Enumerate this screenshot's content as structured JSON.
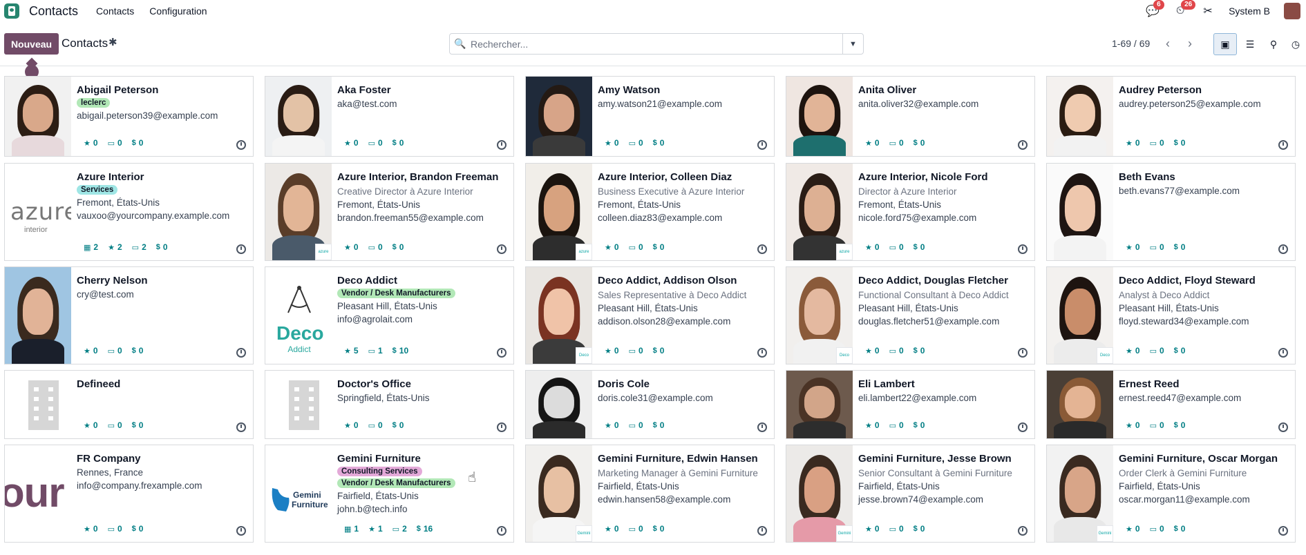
{
  "topnav": {
    "app_name": "Contacts",
    "menu": [
      "Contacts",
      "Configuration"
    ],
    "messages_count": "6",
    "activities_count": "26",
    "user": "System B"
  },
  "control_panel": {
    "new_button": "Nouveau",
    "title": "Contacts",
    "search_placeholder": "Rechercher...",
    "pager": "1-69 / 69"
  },
  "cards": [
    {
      "name": "Abigail Peterson",
      "tags": [
        {
          "label": "leclerc",
          "color": "green"
        }
      ],
      "lines": [
        "abigail.peterson39@example.com"
      ],
      "stats": [
        {
          "icon": "star",
          "val": "0"
        },
        {
          "icon": "card",
          "val": "0"
        },
        {
          "icon": "dollar",
          "val": "0"
        }
      ]
    },
    {
      "name": "Aka Foster",
      "lines": [
        "aka@test.com"
      ],
      "stats": [
        {
          "icon": "star",
          "val": "0"
        },
        {
          "icon": "card",
          "val": "0"
        },
        {
          "icon": "dollar",
          "val": "0"
        }
      ]
    },
    {
      "name": "Amy Watson",
      "lines": [
        "amy.watson21@example.com"
      ],
      "stats": [
        {
          "icon": "star",
          "val": "0"
        },
        {
          "icon": "card",
          "val": "0"
        },
        {
          "icon": "dollar",
          "val": "0"
        }
      ]
    },
    {
      "name": "Anita Oliver",
      "lines": [
        "anita.oliver32@example.com"
      ],
      "stats": [
        {
          "icon": "star",
          "val": "0"
        },
        {
          "icon": "card",
          "val": "0"
        },
        {
          "icon": "dollar",
          "val": "0"
        }
      ]
    },
    {
      "name": "Audrey Peterson",
      "lines": [
        "audrey.peterson25@example.com"
      ],
      "stats": [
        {
          "icon": "star",
          "val": "0"
        },
        {
          "icon": "card",
          "val": "0"
        },
        {
          "icon": "dollar",
          "val": "0"
        }
      ]
    },
    {
      "name": "Azure Interior",
      "tags": [
        {
          "label": "Services",
          "color": "cyan"
        }
      ],
      "lines": [
        "Fremont, États-Unis",
        "vauxoo@yourcompany.example.com"
      ],
      "stats": [
        {
          "icon": "calendar",
          "val": "2"
        },
        {
          "icon": "star",
          "val": "2"
        },
        {
          "icon": "card",
          "val": "2"
        },
        {
          "icon": "dollar",
          "val": "0"
        }
      ]
    },
    {
      "name": "Azure Interior, Brandon Freeman",
      "function": "Creative Director à Azure Interior",
      "lines": [
        "Fremont, États-Unis",
        "brandon.freeman55@example.com"
      ],
      "stats": [
        {
          "icon": "star",
          "val": "0"
        },
        {
          "icon": "card",
          "val": "0"
        },
        {
          "icon": "dollar",
          "val": "0"
        }
      ]
    },
    {
      "name": "Azure Interior, Colleen Diaz",
      "function": "Business Executive à Azure Interior",
      "lines": [
        "Fremont, États-Unis",
        "colleen.diaz83@example.com"
      ],
      "stats": [
        {
          "icon": "star",
          "val": "0"
        },
        {
          "icon": "card",
          "val": "0"
        },
        {
          "icon": "dollar",
          "val": "0"
        }
      ]
    },
    {
      "name": "Azure Interior, Nicole Ford",
      "function": "Director à Azure Interior",
      "lines": [
        "Fremont, États-Unis",
        "nicole.ford75@example.com"
      ],
      "stats": [
        {
          "icon": "star",
          "val": "0"
        },
        {
          "icon": "card",
          "val": "0"
        },
        {
          "icon": "dollar",
          "val": "0"
        }
      ]
    },
    {
      "name": "Beth Evans",
      "lines": [
        "beth.evans77@example.com"
      ],
      "stats": [
        {
          "icon": "star",
          "val": "0"
        },
        {
          "icon": "card",
          "val": "0"
        },
        {
          "icon": "dollar",
          "val": "0"
        }
      ]
    },
    {
      "name": "Cherry Nelson",
      "lines": [
        "cry@test.com"
      ],
      "stats": [
        {
          "icon": "star",
          "val": "0"
        },
        {
          "icon": "card",
          "val": "0"
        },
        {
          "icon": "dollar",
          "val": "0"
        }
      ]
    },
    {
      "name": "Deco Addict",
      "tags": [
        {
          "label": "Vendor / Desk Manufacturers",
          "color": "green"
        }
      ],
      "lines": [
        "Pleasant Hill, États-Unis",
        "info@agrolait.com"
      ],
      "stats": [
        {
          "icon": "star",
          "val": "5"
        },
        {
          "icon": "card",
          "val": "1"
        },
        {
          "icon": "dollar",
          "val": "10"
        }
      ]
    },
    {
      "name": "Deco Addict, Addison Olson",
      "function": "Sales Representative à Deco Addict",
      "lines": [
        "Pleasant Hill, États-Unis",
        "addison.olson28@example.com"
      ],
      "stats": [
        {
          "icon": "star",
          "val": "0"
        },
        {
          "icon": "card",
          "val": "0"
        },
        {
          "icon": "dollar",
          "val": "0"
        }
      ]
    },
    {
      "name": "Deco Addict, Douglas Fletcher",
      "function": "Functional Consultant à Deco Addict",
      "lines": [
        "Pleasant Hill, États-Unis",
        "douglas.fletcher51@example.com"
      ],
      "stats": [
        {
          "icon": "star",
          "val": "0"
        },
        {
          "icon": "card",
          "val": "0"
        },
        {
          "icon": "dollar",
          "val": "0"
        }
      ]
    },
    {
      "name": "Deco Addict, Floyd Steward",
      "function": "Analyst à Deco Addict",
      "lines": [
        "Pleasant Hill, États-Unis",
        "floyd.steward34@example.com"
      ],
      "stats": [
        {
          "icon": "star",
          "val": "0"
        },
        {
          "icon": "card",
          "val": "0"
        },
        {
          "icon": "dollar",
          "val": "0"
        }
      ]
    },
    {
      "name": "Defineed",
      "lines": [],
      "stats": [
        {
          "icon": "star",
          "val": "0"
        },
        {
          "icon": "card",
          "val": "0"
        },
        {
          "icon": "dollar",
          "val": "0"
        }
      ]
    },
    {
      "name": "Doctor's Office",
      "lines": [
        "Springfield, États-Unis"
      ],
      "stats": [
        {
          "icon": "star",
          "val": "0"
        },
        {
          "icon": "card",
          "val": "0"
        },
        {
          "icon": "dollar",
          "val": "0"
        }
      ]
    },
    {
      "name": "Doris Cole",
      "lines": [
        "doris.cole31@example.com"
      ],
      "stats": [
        {
          "icon": "star",
          "val": "0"
        },
        {
          "icon": "card",
          "val": "0"
        },
        {
          "icon": "dollar",
          "val": "0"
        }
      ]
    },
    {
      "name": "Eli Lambert",
      "lines": [
        "eli.lambert22@example.com"
      ],
      "stats": [
        {
          "icon": "star",
          "val": "0"
        },
        {
          "icon": "card",
          "val": "0"
        },
        {
          "icon": "dollar",
          "val": "0"
        }
      ]
    },
    {
      "name": "Ernest Reed",
      "lines": [
        "ernest.reed47@example.com"
      ],
      "stats": [
        {
          "icon": "star",
          "val": "0"
        },
        {
          "icon": "card",
          "val": "0"
        },
        {
          "icon": "dollar",
          "val": "0"
        }
      ]
    },
    {
      "name": "FR Company",
      "lines": [
        "Rennes, France",
        "info@company.frexample.com"
      ],
      "stats": [
        {
          "icon": "star",
          "val": "0"
        },
        {
          "icon": "card",
          "val": "0"
        },
        {
          "icon": "dollar",
          "val": "0"
        }
      ]
    },
    {
      "name": "Gemini Furniture",
      "tags": [
        {
          "label": "Consulting Services",
          "color": "purple"
        },
        {
          "label": "Vendor / Desk Manufacturers",
          "color": "green"
        }
      ],
      "lines": [
        "Fairfield, États-Unis",
        "john.b@tech.info"
      ],
      "stats": [
        {
          "icon": "calendar",
          "val": "1"
        },
        {
          "icon": "star",
          "val": "1"
        },
        {
          "icon": "card",
          "val": "2"
        },
        {
          "icon": "dollar",
          "val": "16"
        }
      ]
    },
    {
      "name": "Gemini Furniture, Edwin Hansen",
      "function": "Marketing Manager à Gemini Furniture",
      "lines": [
        "Fairfield, États-Unis",
        "edwin.hansen58@example.com"
      ],
      "stats": [
        {
          "icon": "star",
          "val": "0"
        },
        {
          "icon": "card",
          "val": "0"
        },
        {
          "icon": "dollar",
          "val": "0"
        }
      ]
    },
    {
      "name": "Gemini Furniture, Jesse Brown",
      "function": "Senior Consultant à Gemini Furniture",
      "lines": [
        "Fairfield, États-Unis",
        "jesse.brown74@example.com"
      ],
      "stats": [
        {
          "icon": "star",
          "val": "0"
        },
        {
          "icon": "card",
          "val": "0"
        },
        {
          "icon": "dollar",
          "val": "0"
        }
      ]
    },
    {
      "name": "Gemini Furniture, Oscar Morgan",
      "function": "Order Clerk à Gemini Furniture",
      "lines": [
        "Fairfield, États-Unis",
        "oscar.morgan11@example.com"
      ],
      "stats": [
        {
          "icon": "star",
          "val": "0"
        },
        {
          "icon": "card",
          "val": "0"
        },
        {
          "icon": "dollar",
          "val": "0"
        }
      ]
    }
  ],
  "colors": {
    "brand": "#714b67",
    "accent_teal": "#017e84",
    "badge_red": "#e0464a"
  }
}
